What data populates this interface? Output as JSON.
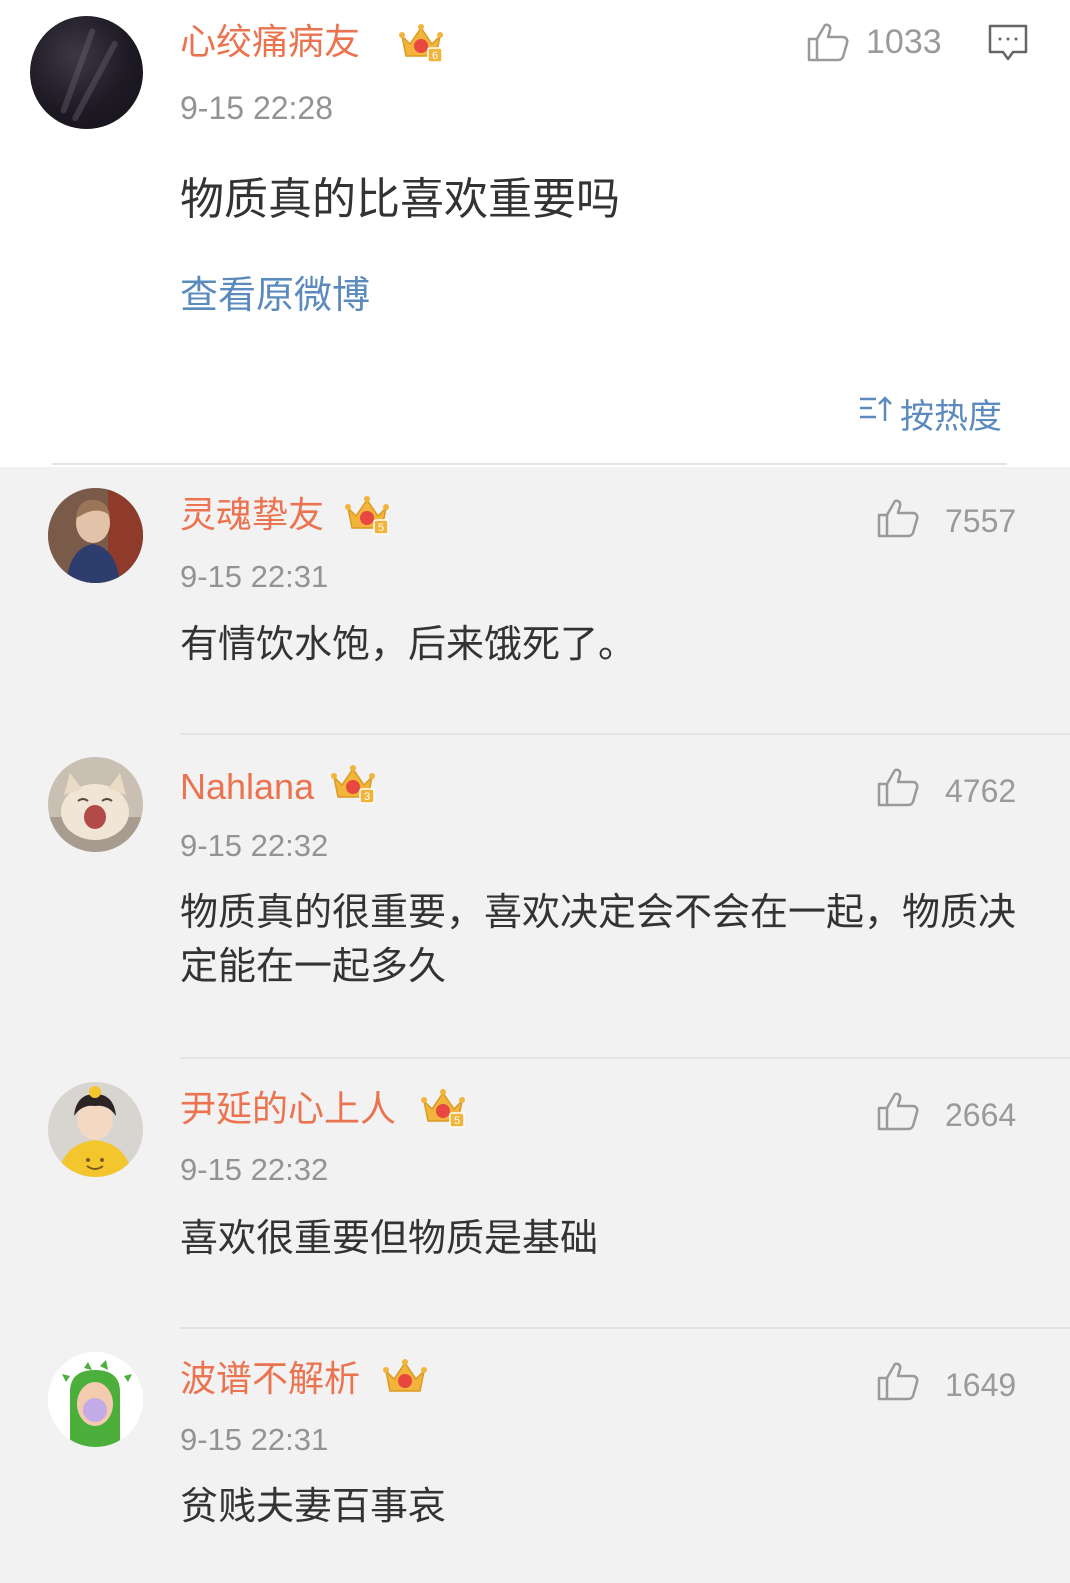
{
  "post": {
    "username": "心绞痛病友",
    "badge_level": "6",
    "time": "9-15 22:28",
    "like_count": "1033",
    "text": "物质真的比喜欢重要吗",
    "view_original": "查看原微博",
    "avatar_icon": "avatar-dark"
  },
  "sort": {
    "label": "按热度",
    "icon": "sort-icon"
  },
  "comments": [
    {
      "username": "灵魂挚友",
      "badge_level": "5",
      "time": "9-15 22:31",
      "like_count": "7557",
      "text": "有情饮水饱，后来饿死了。"
    },
    {
      "username": "Nahlana",
      "badge_level": "3",
      "time": "9-15 22:32",
      "like_count": "4762",
      "text": "物质真的很重要，喜欢决定会不会在一起，物质决定能在一起多久"
    },
    {
      "username": "尹延的心上人",
      "badge_level": "5",
      "time": "9-15 22:32",
      "like_count": "2664",
      "text": "喜欢很重要但物质是基础"
    },
    {
      "username": "波谱不解析",
      "badge_level": "",
      "time": "9-15 22:31",
      "like_count": "1649",
      "text": "贫贱夫妻百事哀"
    }
  ],
  "colors": {
    "username": "#eb7350",
    "link": "#5b8bbd",
    "time": "#939393",
    "crown_gold": "#f2b43a",
    "crown_red": "#e8483f"
  }
}
